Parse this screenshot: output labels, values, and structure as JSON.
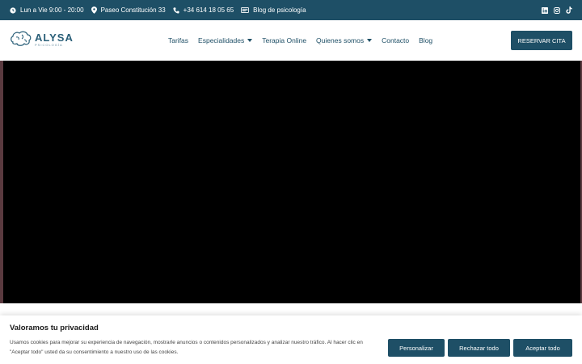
{
  "topbar": {
    "hours": "Lun a Vie 9:00 - 20:00",
    "address": "Paseo Constitución 33",
    "phone": "+34 614 18 05 65",
    "blog": "Blog de psicología",
    "icons": [
      "clock-icon",
      "location-pin-icon",
      "phone-icon",
      "book-icon",
      "linkedin-icon",
      "instagram-icon",
      "tiktok-icon"
    ]
  },
  "header": {
    "logo_name": "ALYSA",
    "logo_sub": "PSICOLOGÍA",
    "nav": [
      {
        "label": "Tarifas"
      },
      {
        "label": "Especialidades"
      },
      {
        "label": "Terapia Online"
      },
      {
        "label": "Quienes somos"
      },
      {
        "label": "Contacto"
      },
      {
        "label": "Blog"
      }
    ],
    "cta_label": "RESERVAR CITA"
  },
  "cookie": {
    "title": "Valoramos tu privacidad",
    "text": "Usamos cookies para mejorar su experiencia de navegación, mostrarle anuncios o contenidos personalizados y analizar nuestro tráfico. Al hacer clic en \"Aceptar todo\" usted da su consentimiento a nuestro uso de las cookies.",
    "customize": "Personalizar",
    "reject": "Rechazar todo",
    "accept": "Aceptar todo"
  },
  "colors": {
    "primary": "#1e4f66",
    "hero_edge": "#5a3a3f",
    "video": "#000000"
  }
}
